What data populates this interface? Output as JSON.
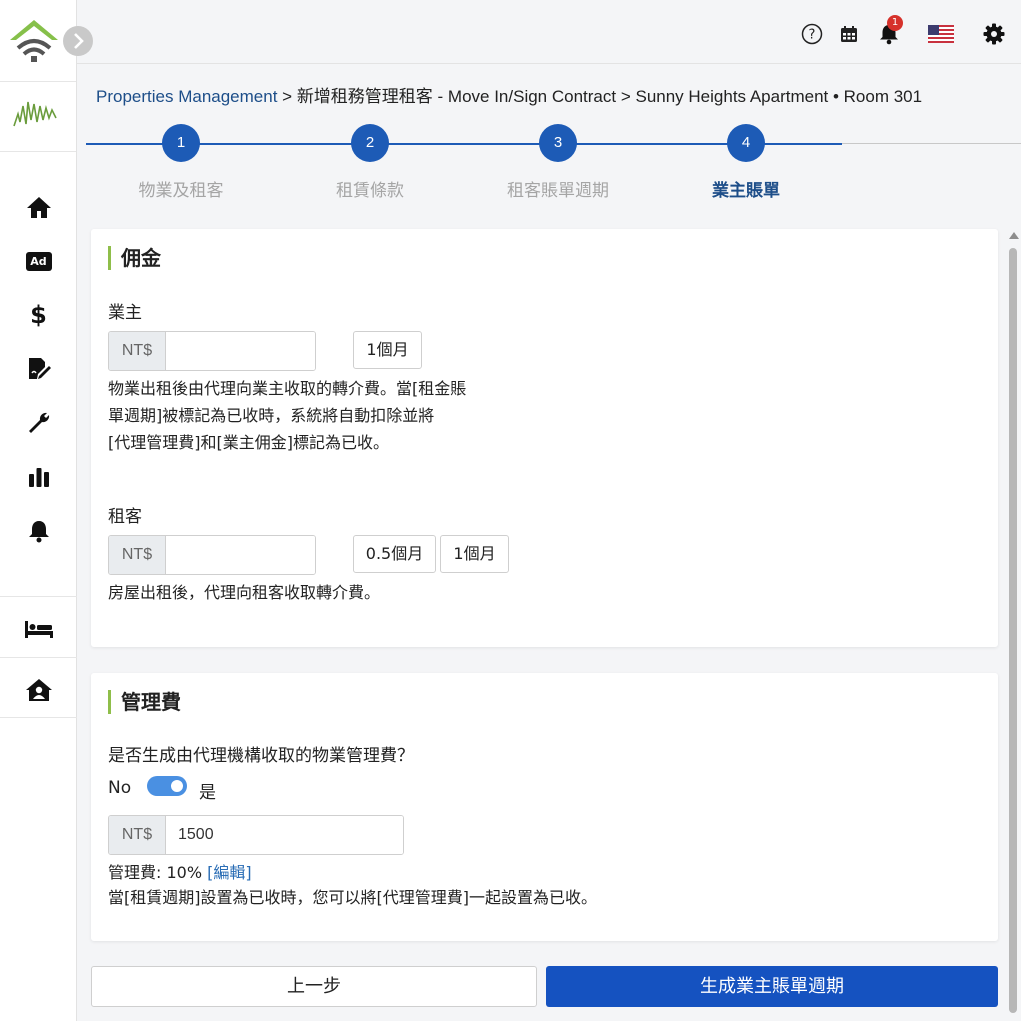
{
  "sidebar": {
    "collapse_icon": "chevron-right-icon",
    "nav_items": [
      {
        "icon": "home-icon"
      },
      {
        "icon": "ad-icon",
        "text": "Ad"
      },
      {
        "icon": "dollar-icon",
        "text": "$"
      },
      {
        "icon": "edit-document-icon"
      },
      {
        "icon": "wrench-icon"
      },
      {
        "icon": "bar-chart-icon"
      },
      {
        "icon": "bell-icon"
      }
    ],
    "bottom_items": [
      {
        "icon": "bed-icon"
      },
      {
        "icon": "house-user-icon"
      }
    ]
  },
  "topbar": {
    "help_icon": "help-icon",
    "calendar_icon": "calendar-icon",
    "notification_icon": "bell-icon",
    "notification_count": "1",
    "language_icon": "us-flag-icon",
    "settings_icon": "gear-icon"
  },
  "breadcrumb": {
    "root": "Properties Management",
    "separator": " > ",
    "rest": "新增租務管理租客 - Move In/Sign Contract > Sunny Heights Apartment • Room 301"
  },
  "stepper": {
    "steps": [
      {
        "number": "1",
        "label": "物業及租客"
      },
      {
        "number": "2",
        "label": "租賃條款"
      },
      {
        "number": "3",
        "label": "租客賬單週期"
      },
      {
        "number": "4",
        "label": "業主賬單"
      }
    ],
    "active_step": 4
  },
  "commission": {
    "title": "佣金",
    "owner_label": "業主",
    "owner_prefix": "NT$",
    "owner_value": "",
    "owner_chip": "1個月",
    "owner_desc": [
      "物業出租後由代理向業主收取的轉介費。當[租金賬",
      "單週期]被標記為已收時，系統將自動扣除並將",
      "[代理管理費]和[業主佣金]標記為已收。"
    ],
    "tenant_label": "租客",
    "tenant_prefix": "NT$",
    "tenant_value": "",
    "tenant_chip_1": "0.5個月",
    "tenant_chip_2": "1個月",
    "tenant_desc": "房屋出租後，代理向租客收取轉介費。"
  },
  "management": {
    "title": "管理費",
    "question": "是否生成由代理機構收取的物業管理費？",
    "toggle_off_label": "No",
    "toggle_on_label": "是",
    "toggle_on": true,
    "prefix": "NT$",
    "value": "1500",
    "fee_label": "管理費: 10% ",
    "fee_edit": "[編輯]",
    "note": "當[租賃週期]設置為已收時，您可以將[代理管理費]一起設置為已收。"
  },
  "actions": {
    "prev_label": "上一步",
    "next_label": "生成業主賬單週期"
  },
  "colors": {
    "primary": "#1552c0",
    "step": "#1d5bb6",
    "accent_bar": "#8fbe4a",
    "badge": "#d6312b"
  }
}
